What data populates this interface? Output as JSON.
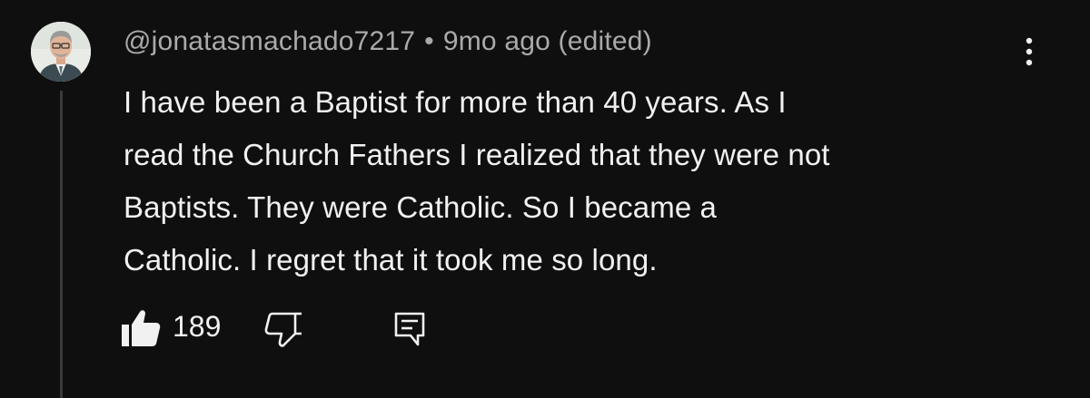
{
  "comment": {
    "author": "@jonatasmachado7217",
    "separator": "•",
    "timestamp": "9mo ago (edited)",
    "text_lines": [
      "I have been a Baptist for more than 40 years. As I",
      "read the Church Fathers I realized that they were not",
      "Baptists. They were Catholic. So I became a",
      "Catholic. I regret that it took me so long."
    ],
    "like_count": "189"
  },
  "icons": {
    "avatar": "avatar-photo",
    "like": "thumbs-up-filled-icon",
    "dislike": "thumbs-down-outline-icon",
    "reply": "reply-comment-icon",
    "menu": "more-vertical-icon"
  },
  "colors": {
    "background": "#0f0f0f",
    "primary_text": "#f1f1f1",
    "secondary_text": "#aaaaaa",
    "thread_line": "#3a3a3a"
  }
}
